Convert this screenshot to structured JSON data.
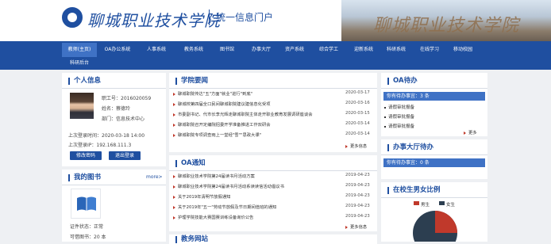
{
  "header": {
    "school_name": "聊城职业技术学院",
    "portal_name": "统一信息门户",
    "banner_text": "聊城职业技术学院"
  },
  "nav": {
    "items": [
      {
        "label": "教师(主页)"
      },
      {
        "label": "OA办公系统"
      },
      {
        "label": "人事系统"
      },
      {
        "label": "教务系统"
      },
      {
        "label": "图书馆"
      },
      {
        "label": "办事大厅"
      },
      {
        "label": "资产系统"
      },
      {
        "label": "综合学工"
      },
      {
        "label": "迎新系统"
      },
      {
        "label": "科研系统"
      },
      {
        "label": "在线学习"
      },
      {
        "label": "移动校园"
      },
      {
        "label": "科研后台"
      }
    ]
  },
  "personal": {
    "title": "个人信息",
    "job_no": "职工号：2016020059",
    "name": "姓名：蔡德玲",
    "dept": "部门：信息技术中心",
    "last_login_time": "上次登录时间：2020-03-18 14:00",
    "last_login_ip": "上次登录IP：192.168.111.3",
    "change_pwd": "修改密码",
    "logout": "退出登录"
  },
  "library": {
    "title": "我的图书",
    "more": "more>",
    "cert_status": "证件状态：正常",
    "can_borrow": "可借图书：20 本"
  },
  "news": {
    "title": "学院要闻",
    "items": [
      {
        "text": "聊城职院传达\"五\"方面\"就业\"进行\"到底\"",
        "date": "2020-03-17"
      },
      {
        "text": "聊城校第四届全口民间聊城职院建议建信息化受项",
        "date": "2020-03-16"
      },
      {
        "text": "市委副书记、代市长李光辉走聊城职院主体走开职业教育发展调研座谈会",
        "date": "2020-03-15"
      },
      {
        "text": "聊城职院召开定编院招委开学准备推进工作双研会",
        "date": "2020-03-14"
      },
      {
        "text": "聊城职院专项调查雨上一堂经\"雪\"\"思政大课\"",
        "date": "2020-03-14"
      }
    ],
    "more": "更多信息"
  },
  "oa_notice": {
    "title": "OA通知",
    "items": [
      {
        "text": "聊城职业技术学院第24届读书月活动方案",
        "date": "2019-04-23"
      },
      {
        "text": "聊城职业技术学院第24届读书月活动系读读信活动倡议书",
        "date": "2019-04-23"
      },
      {
        "text": "关于2019年清明节放假通知",
        "date": "2019-04-23"
      },
      {
        "text": "关于2019年\"五一\"劳动节放假及节日期间值班的通知",
        "date": "2019-04-23"
      },
      {
        "text": "护理学院技能大赛国赛训练设备询价公告",
        "date": "2019-04-23"
      }
    ],
    "more": "更多信息"
  },
  "edu_title": "教务网站",
  "oa_todo": {
    "title": "OA待办",
    "bar": "你有待办事宜：3 条",
    "items": [
      {
        "label": "请假审批报备"
      },
      {
        "label": "请假审批报备"
      },
      {
        "label": "请假审批报备"
      }
    ],
    "more": "更多"
  },
  "hall_todo": {
    "title": "办事大厅待办",
    "bar": "你有待办事宜：0 条"
  },
  "gender": {
    "title": "在校生男女比例",
    "male_label": "男生",
    "female_label": "女生",
    "male_color": "#c0392b",
    "female_color": "#2c3e50"
  },
  "colors": {
    "brand": "#1f4fa0",
    "nav_active": "#3f72c5",
    "bullet": "#c0392b"
  }
}
